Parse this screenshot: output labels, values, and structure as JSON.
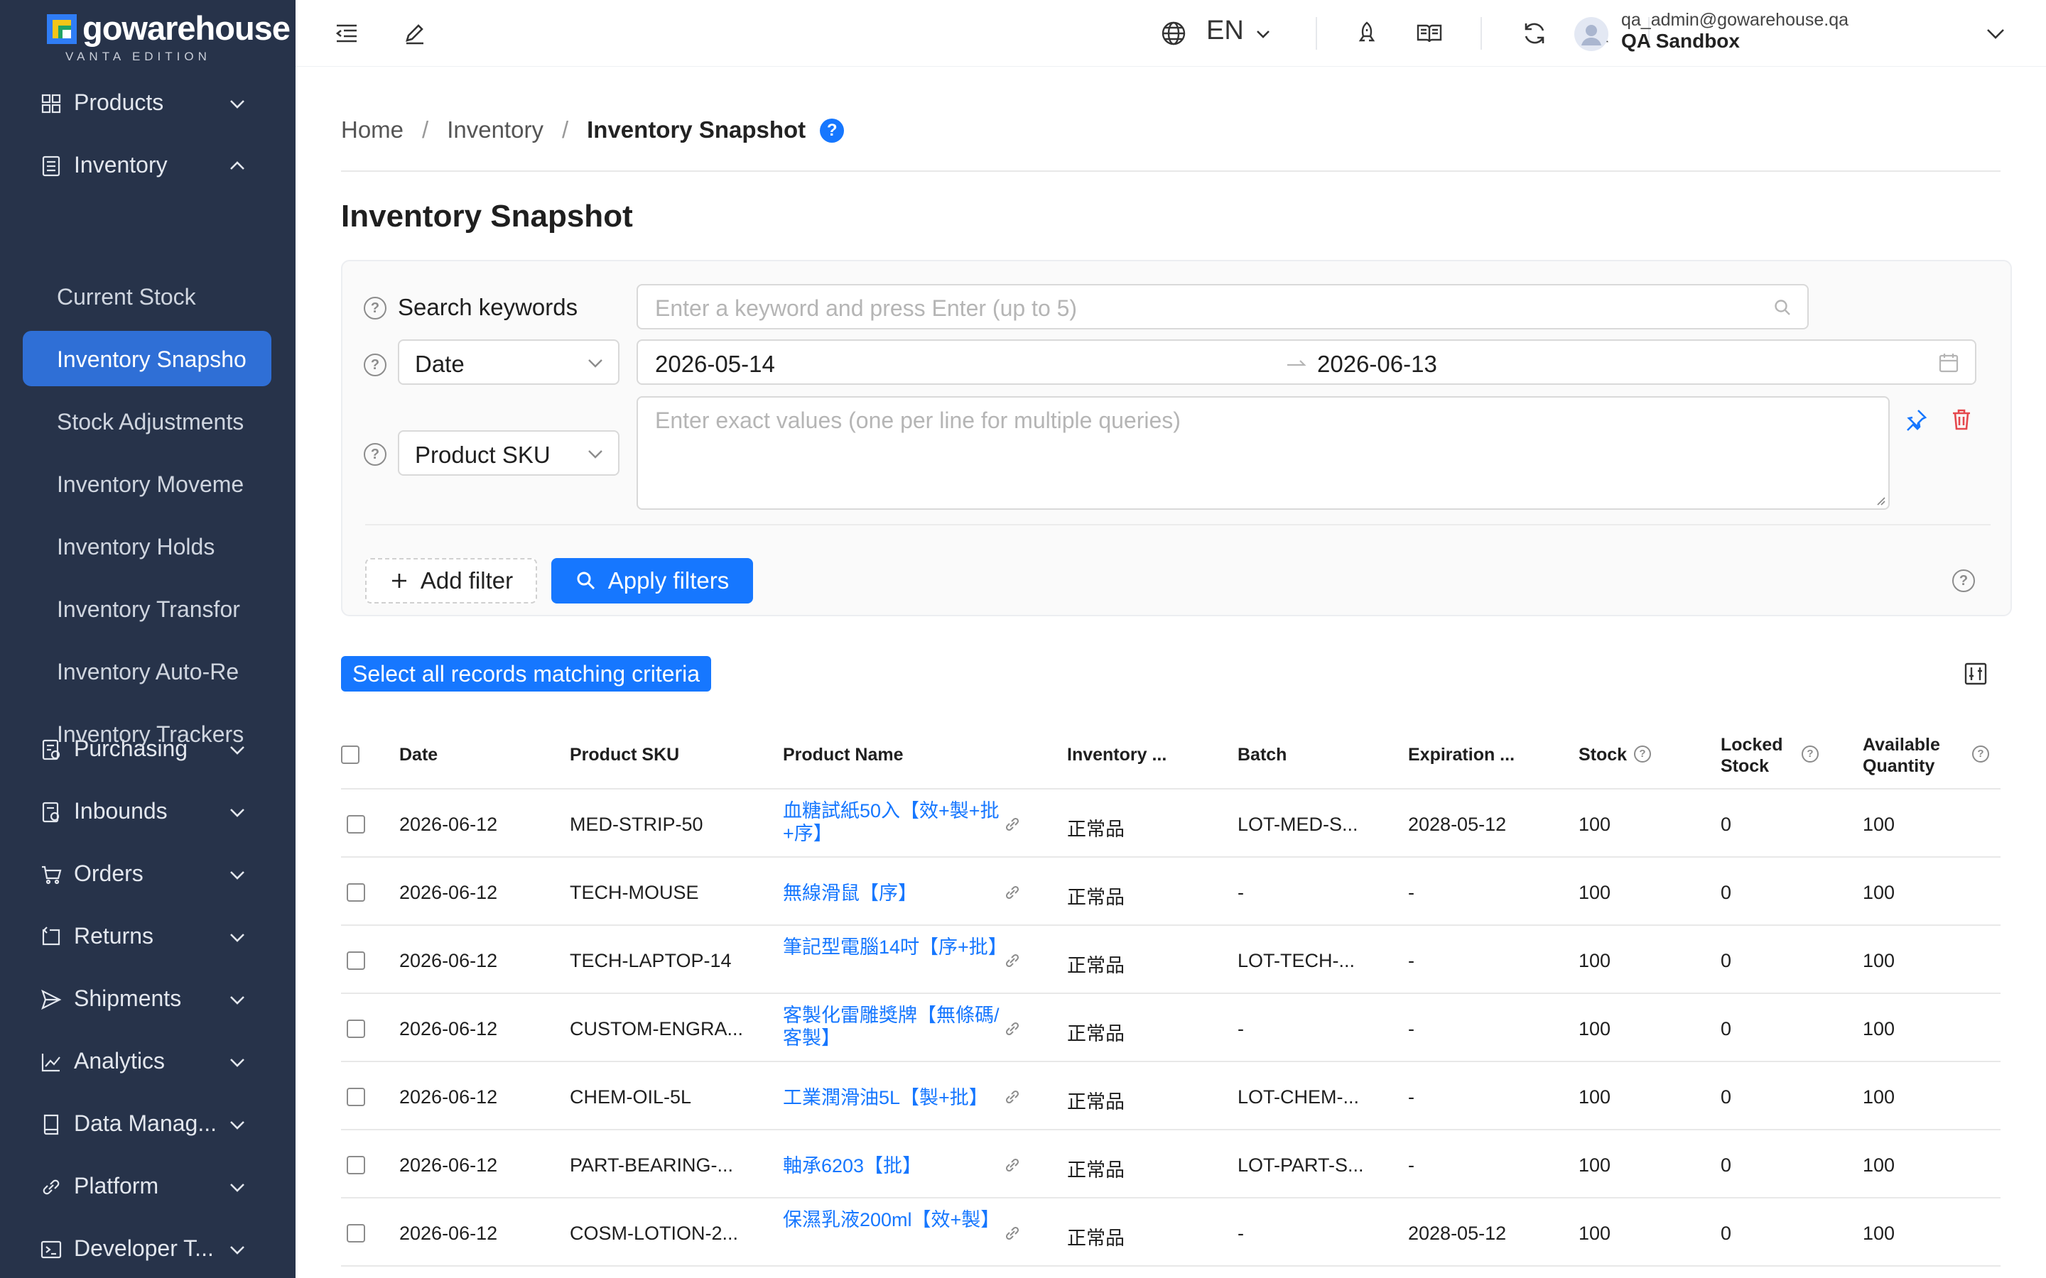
{
  "app": {
    "logo_text": "gowarehouse",
    "logo_sub": "VANTA EDITION"
  },
  "sidebar": {
    "items": [
      {
        "label": "Products",
        "icon": "grid-icon",
        "expanded": false
      },
      {
        "label": "Inventory",
        "icon": "inventory-icon",
        "expanded": true
      },
      {
        "label": "Purchasing",
        "icon": "purchasing-icon",
        "expanded": false
      },
      {
        "label": "Inbounds",
        "icon": "inbounds-icon",
        "expanded": false
      },
      {
        "label": "Orders",
        "icon": "cart-icon",
        "expanded": false
      },
      {
        "label": "Returns",
        "icon": "return-icon",
        "expanded": false
      },
      {
        "label": "Shipments",
        "icon": "send-icon",
        "expanded": false
      },
      {
        "label": "Analytics",
        "icon": "chart-icon",
        "expanded": false
      },
      {
        "label": "Data Manag...",
        "icon": "book-icon",
        "expanded": false
      },
      {
        "label": "Platform",
        "icon": "link-icon",
        "expanded": false
      },
      {
        "label": "Developer T...",
        "icon": "terminal-icon",
        "expanded": false
      }
    ],
    "inventory_sub": [
      {
        "label": "Current Stock",
        "active": false
      },
      {
        "label": "Inventory Snapsho",
        "active": true
      },
      {
        "label": "Stock Adjustments",
        "active": false
      },
      {
        "label": "Inventory Moveme",
        "active": false
      },
      {
        "label": "Inventory Holds",
        "active": false
      },
      {
        "label": "Inventory Transfor",
        "active": false
      },
      {
        "label": "Inventory Auto-Re",
        "active": false
      },
      {
        "label": "Inventory Trackers",
        "active": false
      }
    ]
  },
  "topbar": {
    "language": "EN",
    "user_email": "qa_admin@gowarehouse.qa",
    "user_org": "QA Sandbox"
  },
  "breadcrumb": {
    "home": "Home",
    "parent": "Inventory",
    "current": "Inventory Snapshot"
  },
  "page": {
    "title": "Inventory Snapshot"
  },
  "filters": {
    "search_label": "Search keywords",
    "search_placeholder": "Enter a keyword and press Enter (up to 5)",
    "date_field": "Date",
    "date_start": "2026-05-14",
    "date_end": "2026-06-13",
    "sku_field": "Product SKU",
    "sku_placeholder": "Enter exact values (one per line for multiple queries)",
    "add_filter": "Add filter",
    "apply": "Apply filters"
  },
  "table": {
    "select_all": "Select all records matching criteria",
    "columns": [
      "Date",
      "Product SKU",
      "Product Name",
      "Inventory ...",
      "Batch",
      "Expiration ...",
      "Stock",
      "Locked Stock",
      "Available Quantity"
    ],
    "rows": [
      {
        "date": "2026-06-12",
        "sku": "MED-STRIP-50",
        "name": "血糖試紙50入【效+製+批+序】",
        "inv": "正常品",
        "batch": "LOT-MED-S...",
        "exp": "2028-05-12",
        "stock": "100",
        "locked": "0",
        "avail": "100"
      },
      {
        "date": "2026-06-12",
        "sku": "TECH-MOUSE",
        "name": "無線滑鼠【序】",
        "inv": "正常品",
        "batch": "-",
        "exp": "-",
        "stock": "100",
        "locked": "0",
        "avail": "100"
      },
      {
        "date": "2026-06-12",
        "sku": "TECH-LAPTOP-14",
        "name": "筆記型電腦14吋【序+批】",
        "inv": "正常品",
        "batch": "LOT-TECH-...",
        "exp": "-",
        "stock": "100",
        "locked": "0",
        "avail": "100"
      },
      {
        "date": "2026-06-12",
        "sku": "CUSTOM-ENGRA...",
        "name": "客製化雷雕獎牌【無條碼/客製】",
        "inv": "正常品",
        "batch": "-",
        "exp": "-",
        "stock": "100",
        "locked": "0",
        "avail": "100"
      },
      {
        "date": "2026-06-12",
        "sku": "CHEM-OIL-5L",
        "name": "工業潤滑油5L【製+批】",
        "inv": "正常品",
        "batch": "LOT-CHEM-...",
        "exp": "-",
        "stock": "100",
        "locked": "0",
        "avail": "100"
      },
      {
        "date": "2026-06-12",
        "sku": "PART-BEARING-...",
        "name": "軸承6203【批】",
        "inv": "正常品",
        "batch": "LOT-PART-S...",
        "exp": "-",
        "stock": "100",
        "locked": "0",
        "avail": "100"
      },
      {
        "date": "2026-06-12",
        "sku": "COSM-LOTION-2...",
        "name": "保濕乳液200ml【效+製】",
        "inv": "正常品",
        "batch": "-",
        "exp": "2028-05-12",
        "stock": "100",
        "locked": "0",
        "avail": "100"
      }
    ]
  },
  "colors": {
    "sidebar_bg": "#27334a",
    "accent": "#1677ff",
    "active_nav": "#2f6fd6",
    "danger": "#e5484d"
  }
}
